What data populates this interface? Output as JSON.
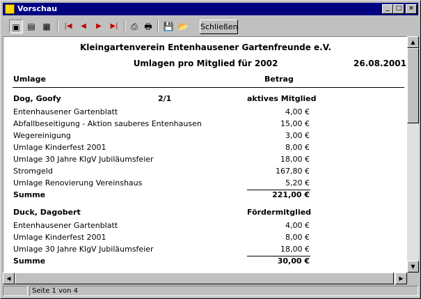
{
  "window": {
    "title": "Vorschau"
  },
  "toolbar": {
    "close_label": "Schließen"
  },
  "report": {
    "org": "Kleingartenverein Entenhausener Gartenfreunde e.V.",
    "subtitle": "Umlagen pro Mitglied für 2002",
    "date": "26.08.2001",
    "col_left": "Umlage",
    "col_right": "Betrag",
    "members": [
      {
        "name": "Dog, Goofy",
        "code": "2/1",
        "status": "aktives Mitglied",
        "items": [
          {
            "label": "Entenhausener Gartenblatt",
            "amount": "4,00 €"
          },
          {
            "label": "Abfallbeseitigung - Aktion sauberes Entenhausen",
            "amount": "15,00 €"
          },
          {
            "label": "Wegereinigung",
            "amount": "3,00 €"
          },
          {
            "label": "Umlage Kinderfest 2001",
            "amount": "8,00 €"
          },
          {
            "label": "Umlage 30 Jahre KlgV Jubiläumsfeier",
            "amount": "18,00 €"
          },
          {
            "label": "Stromgeld",
            "amount": "167,80 €"
          },
          {
            "label": "Umlage Renovierung Vereinshaus",
            "amount": "5,20 €"
          }
        ],
        "sum_label": "Summe",
        "sum": "221,00 €"
      },
      {
        "name": "Duck, Dagobert",
        "code": "",
        "status": "Fördermitglied",
        "items": [
          {
            "label": "Entenhausener Gartenblatt",
            "amount": "4,00 €"
          },
          {
            "label": "Umlage Kinderfest 2001",
            "amount": "8,00 €"
          },
          {
            "label": "Umlage 30 Jahre KlgV Jubiläumsfeier",
            "amount": "18,00 €"
          }
        ],
        "sum_label": "Summe",
        "sum": "30,00 €"
      }
    ]
  },
  "statusbar": {
    "page": "Seite 1 von 4"
  }
}
